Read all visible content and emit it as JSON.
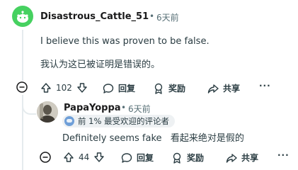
{
  "comments": [
    {
      "username": "Disastrous_Cattle_51",
      "separator": "•",
      "timestamp": "6天前",
      "lines": [
        "I believe this was proven to be false.",
        "我认为这已被证明是错误的。"
      ],
      "actions": {
        "score": "102",
        "reply_label": "回复",
        "award_label": "奖励",
        "share_label": "共享",
        "more_label": "···"
      }
    },
    {
      "username": "PapaYoppa",
      "separator": "•",
      "timestamp": "6天前",
      "flair": "前 1% 最受欢迎的评论者",
      "lines": [
        "Definitely seems fake   看起来绝对是假的"
      ],
      "actions": {
        "score": "44",
        "reply_label": "回复",
        "award_label": "奖励",
        "share_label": "共享",
        "more_label": "···"
      }
    }
  ],
  "colors": {
    "avatar_green": "#46d160",
    "text": "#2a3c42",
    "muted": "#576f76"
  }
}
